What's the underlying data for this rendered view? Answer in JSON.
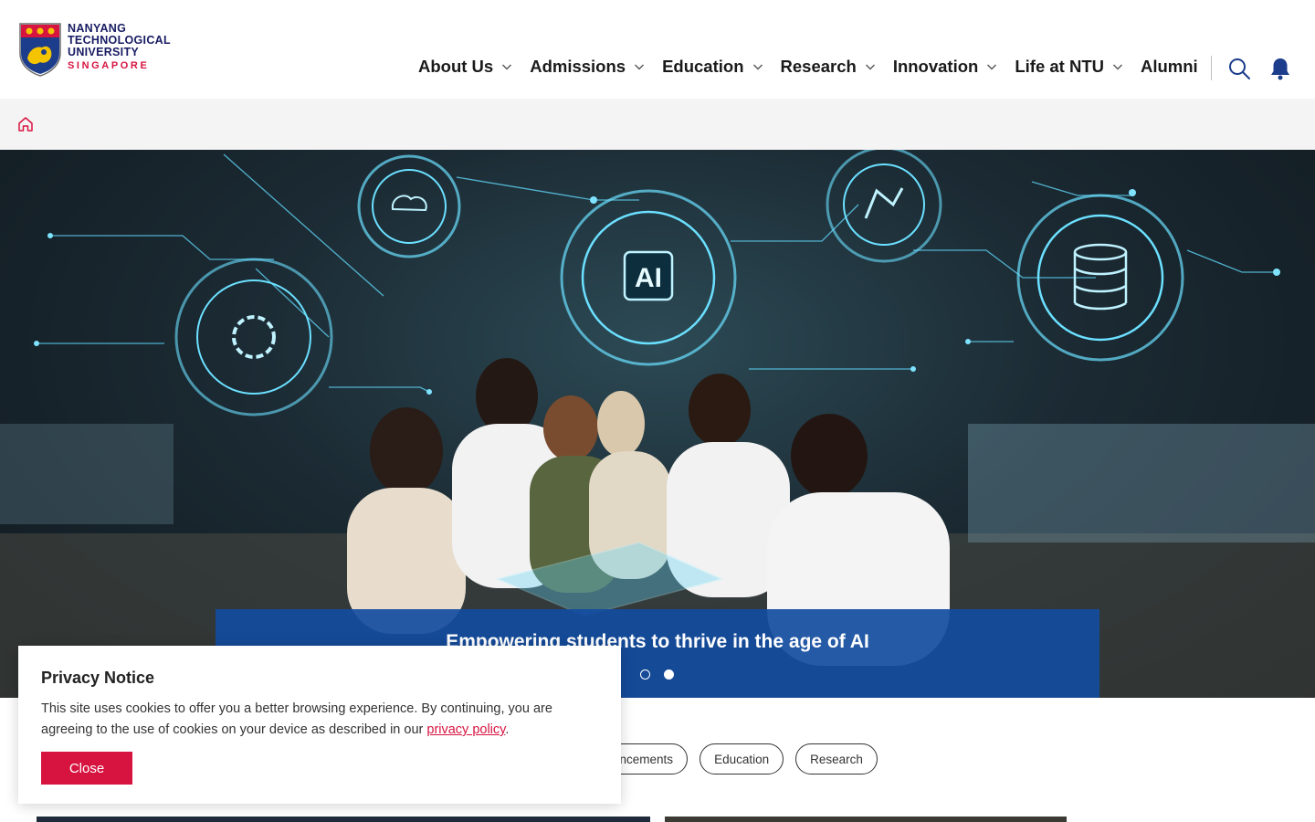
{
  "header": {
    "logo": {
      "line1": "NANYANG",
      "line2": "TECHNOLOGICAL",
      "line3": "UNIVERSITY",
      "line4": "SINGAPORE"
    },
    "nav": [
      {
        "label": "About Us",
        "has_dropdown": true
      },
      {
        "label": "Admissions",
        "has_dropdown": true
      },
      {
        "label": "Education",
        "has_dropdown": true
      },
      {
        "label": "Research",
        "has_dropdown": true
      },
      {
        "label": "Innovation",
        "has_dropdown": true
      },
      {
        "label": "Life at NTU",
        "has_dropdown": true
      },
      {
        "label": "Alumni",
        "has_dropdown": false
      }
    ],
    "icons": {
      "search": "search-icon",
      "notifications": "bell-icon"
    }
  },
  "breadcrumb": {
    "home_icon": "home-icon"
  },
  "hero": {
    "caption": "Empowering students to thrive in the age of AI",
    "slides": 2,
    "active_slide": 2,
    "hologram_labels": [
      "AI"
    ]
  },
  "filters": {
    "chips": [
      "nouncements",
      "Education",
      "Research"
    ]
  },
  "privacy": {
    "title": "Privacy Notice",
    "body_prefix": "This site uses cookies to offer you a better browsing experience. By continuing, you are agreeing to the use of cookies on your device as described in our ",
    "link_text": "privacy policy",
    "body_suffix": ".",
    "close_label": "Close"
  },
  "colors": {
    "brand_red": "#d71440",
    "brand_navy": "#181c62",
    "caption_blue": "#124ca0",
    "breadcrumb_bg": "#f4f4f4"
  }
}
